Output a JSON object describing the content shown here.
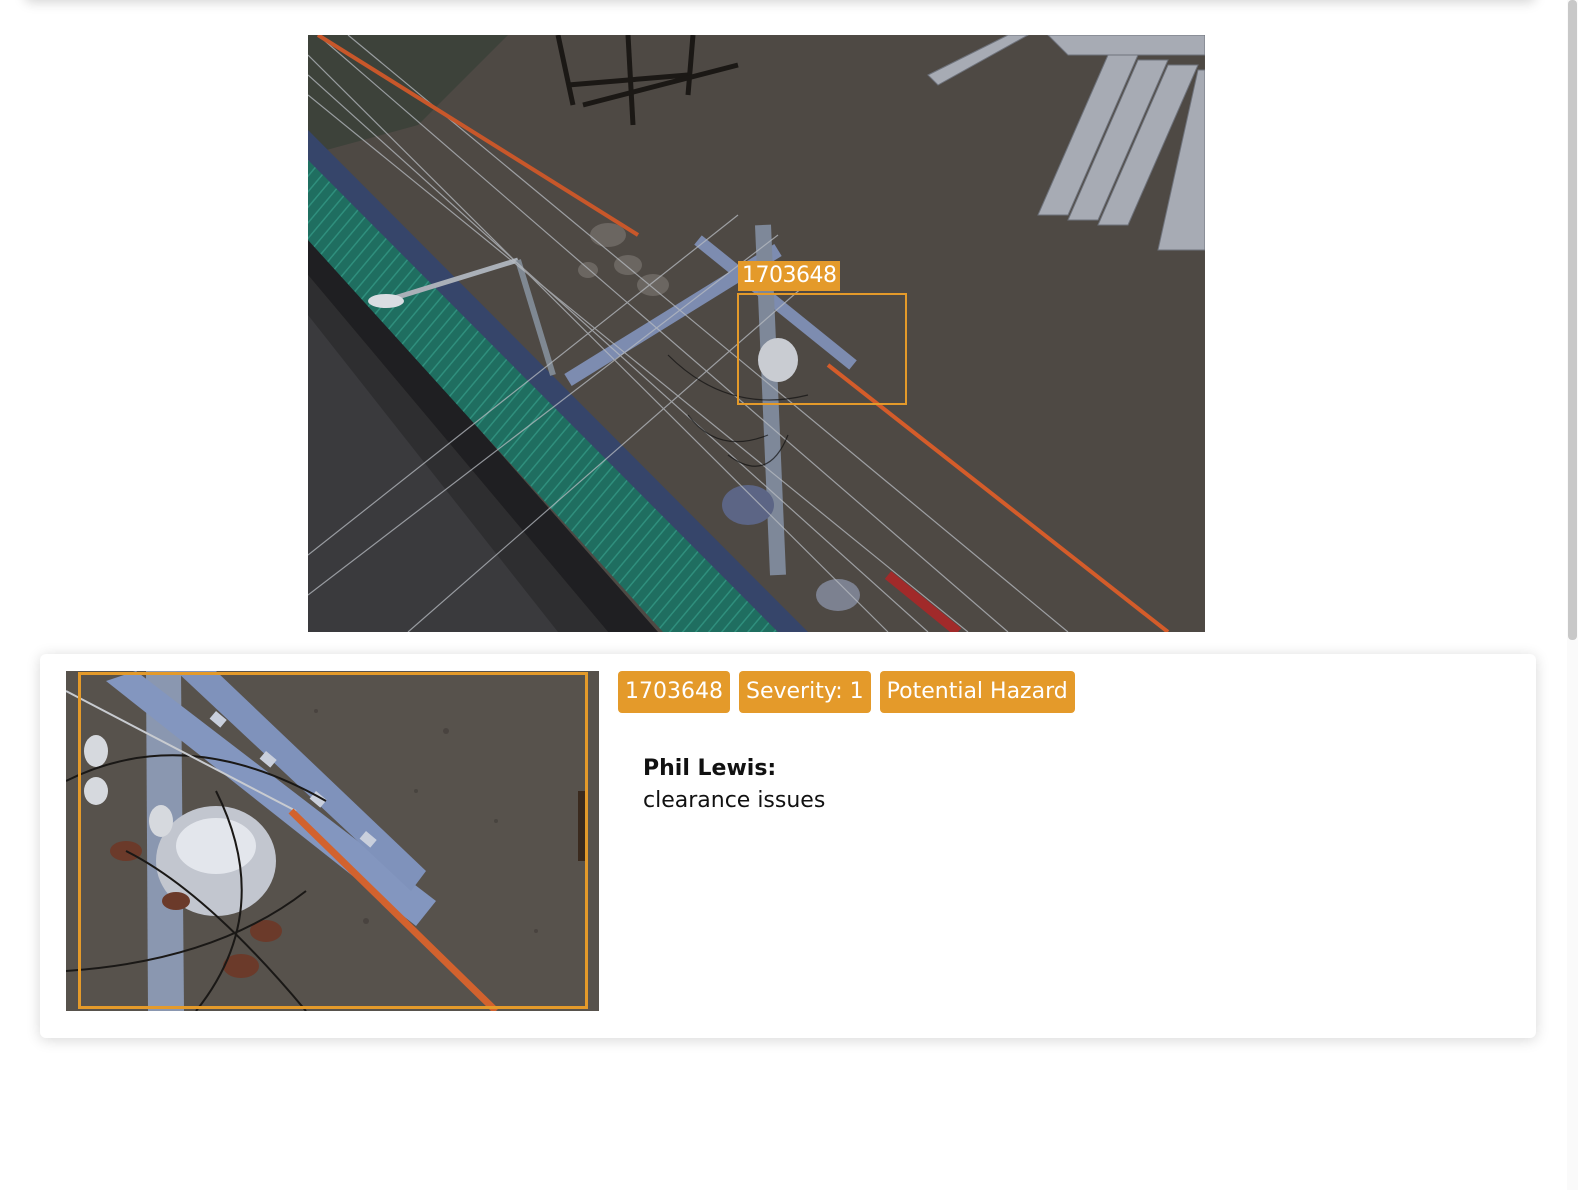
{
  "detection": {
    "label": "1703648"
  },
  "tags": [
    {
      "text": "1703648"
    },
    {
      "text": "Severity: 1"
    },
    {
      "text": "Potential Hazard"
    }
  ],
  "comment": {
    "author": "Phil Lewis:",
    "text": "clearance issues"
  },
  "colors": {
    "accent": "#e49a2a",
    "card_bg": "#ffffff"
  }
}
